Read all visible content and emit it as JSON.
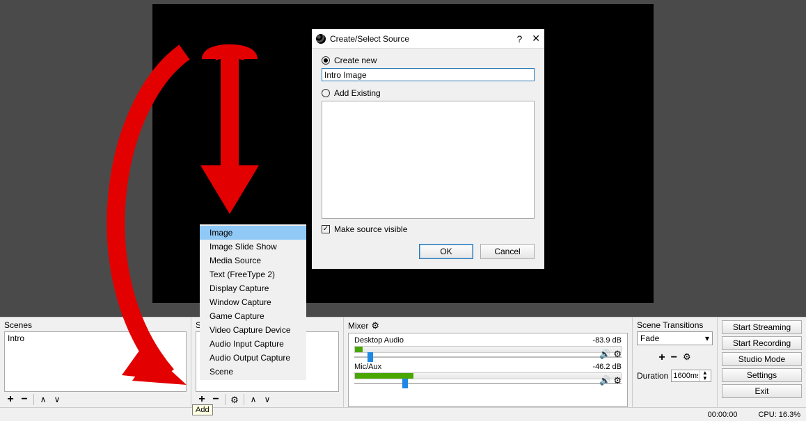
{
  "scenes": {
    "label": "Scenes",
    "items": [
      "Intro"
    ]
  },
  "sources": {
    "label": "Sources"
  },
  "mixer": {
    "label": "Mixer",
    "channels": [
      {
        "name": "Desktop Audio",
        "db": "-83.9 dB",
        "fill_pct": 3,
        "thumb_pct": 5
      },
      {
        "name": "Mic/Aux",
        "db": "-46.2 dB",
        "fill_pct": 22,
        "thumb_pct": 18
      }
    ]
  },
  "transitions": {
    "label": "Scene Transitions",
    "selected": "Fade",
    "duration_label": "Duration",
    "duration_value": "1600ms"
  },
  "side_buttons": {
    "stream": "Start Streaming",
    "record": "Start Recording",
    "studio": "Studio Mode",
    "settings": "Settings",
    "exit": "Exit"
  },
  "context_menu": {
    "items": [
      "Image",
      "Image Slide Show",
      "Media Source",
      "Text (FreeType 2)",
      "Display Capture",
      "Window Capture",
      "Game Capture",
      "Video Capture Device",
      "Audio Input Capture",
      "Audio Output Capture",
      "Scene"
    ],
    "selected_index": 0
  },
  "dialog": {
    "title": "Create/Select Source",
    "create_new": "Create new",
    "name_value": "Intro Image",
    "add_existing": "Add Existing",
    "make_visible": "Make source visible",
    "ok": "OK",
    "cancel": "Cancel"
  },
  "tooltip": {
    "add": "Add"
  },
  "status": {
    "time": "00:00:00",
    "cpu": "CPU: 16.3%"
  }
}
